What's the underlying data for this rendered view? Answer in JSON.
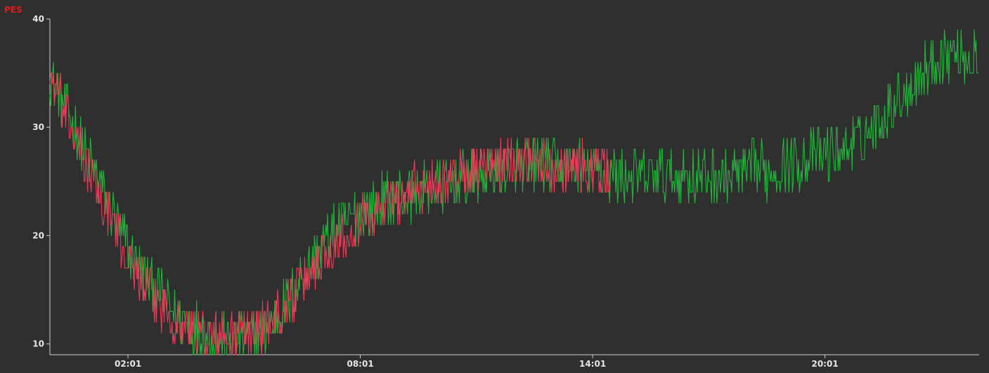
{
  "chart_data": {
    "type": "line",
    "ylabel": "PES",
    "ylim": [
      9,
      40
    ],
    "xlim": [
      "00:00",
      "24:00"
    ],
    "yticks": [
      10,
      20,
      30,
      40
    ],
    "xticks": [
      "02:01",
      "08:01",
      "14:01",
      "20:01"
    ],
    "grid": false,
    "legend": "none",
    "series": [
      {
        "color": "#1fb53a",
        "x": [
          "00:00",
          "00:30",
          "01:00",
          "01:30",
          "02:00",
          "02:30",
          "03:00",
          "03:30",
          "04:00",
          "04:30",
          "05:00",
          "05:30",
          "06:00",
          "06:30",
          "07:00",
          "07:30",
          "08:00",
          "08:30",
          "09:00",
          "09:30",
          "10:00",
          "10:30",
          "11:00",
          "11:30",
          "12:00",
          "12:30",
          "13:00",
          "13:30",
          "14:00",
          "14:30",
          "15:00",
          "15:30",
          "16:00",
          "16:30",
          "17:00",
          "17:30",
          "18:00",
          "18:30",
          "19:00",
          "19:30",
          "20:00",
          "20:30",
          "21:00",
          "21:30",
          "22:00",
          "22:30",
          "23:00",
          "23:30",
          "24:00"
        ],
        "values": [
          35,
          31,
          27,
          23,
          19,
          16,
          14,
          12,
          11,
          10,
          10.5,
          11,
          13,
          16,
          19,
          21,
          22,
          23,
          23.5,
          24,
          24.5,
          25,
          25.5,
          26,
          26.5,
          26.5,
          26.5,
          26.5,
          26,
          25.5,
          25.5,
          25.5,
          25.5,
          25.5,
          25.5,
          25.5,
          26,
          26,
          26.5,
          27,
          27.5,
          28,
          29,
          31,
          33,
          35,
          36.5,
          37,
          36
        ]
      },
      {
        "color": "#f23658",
        "x": [
          "00:00",
          "00:30",
          "01:00",
          "01:30",
          "02:00",
          "02:30",
          "03:00",
          "03:30",
          "04:00",
          "04:30",
          "05:00",
          "05:30",
          "06:00",
          "06:30",
          "07:00",
          "07:30",
          "08:00",
          "08:30",
          "09:00",
          "09:30",
          "10:00",
          "10:30",
          "11:00",
          "11:30",
          "12:00",
          "12:30",
          "13:00",
          "13:30",
          "14:00",
          "14:30"
        ],
        "values": [
          35,
          30,
          26,
          22,
          18,
          15,
          13,
          11.5,
          11,
          10.5,
          11,
          11.5,
          13,
          15.5,
          18,
          20,
          21.5,
          22.5,
          23.5,
          24.5,
          25,
          25.5,
          26,
          26.5,
          27,
          27,
          26.5,
          26.5,
          26,
          26
        ]
      }
    ]
  }
}
